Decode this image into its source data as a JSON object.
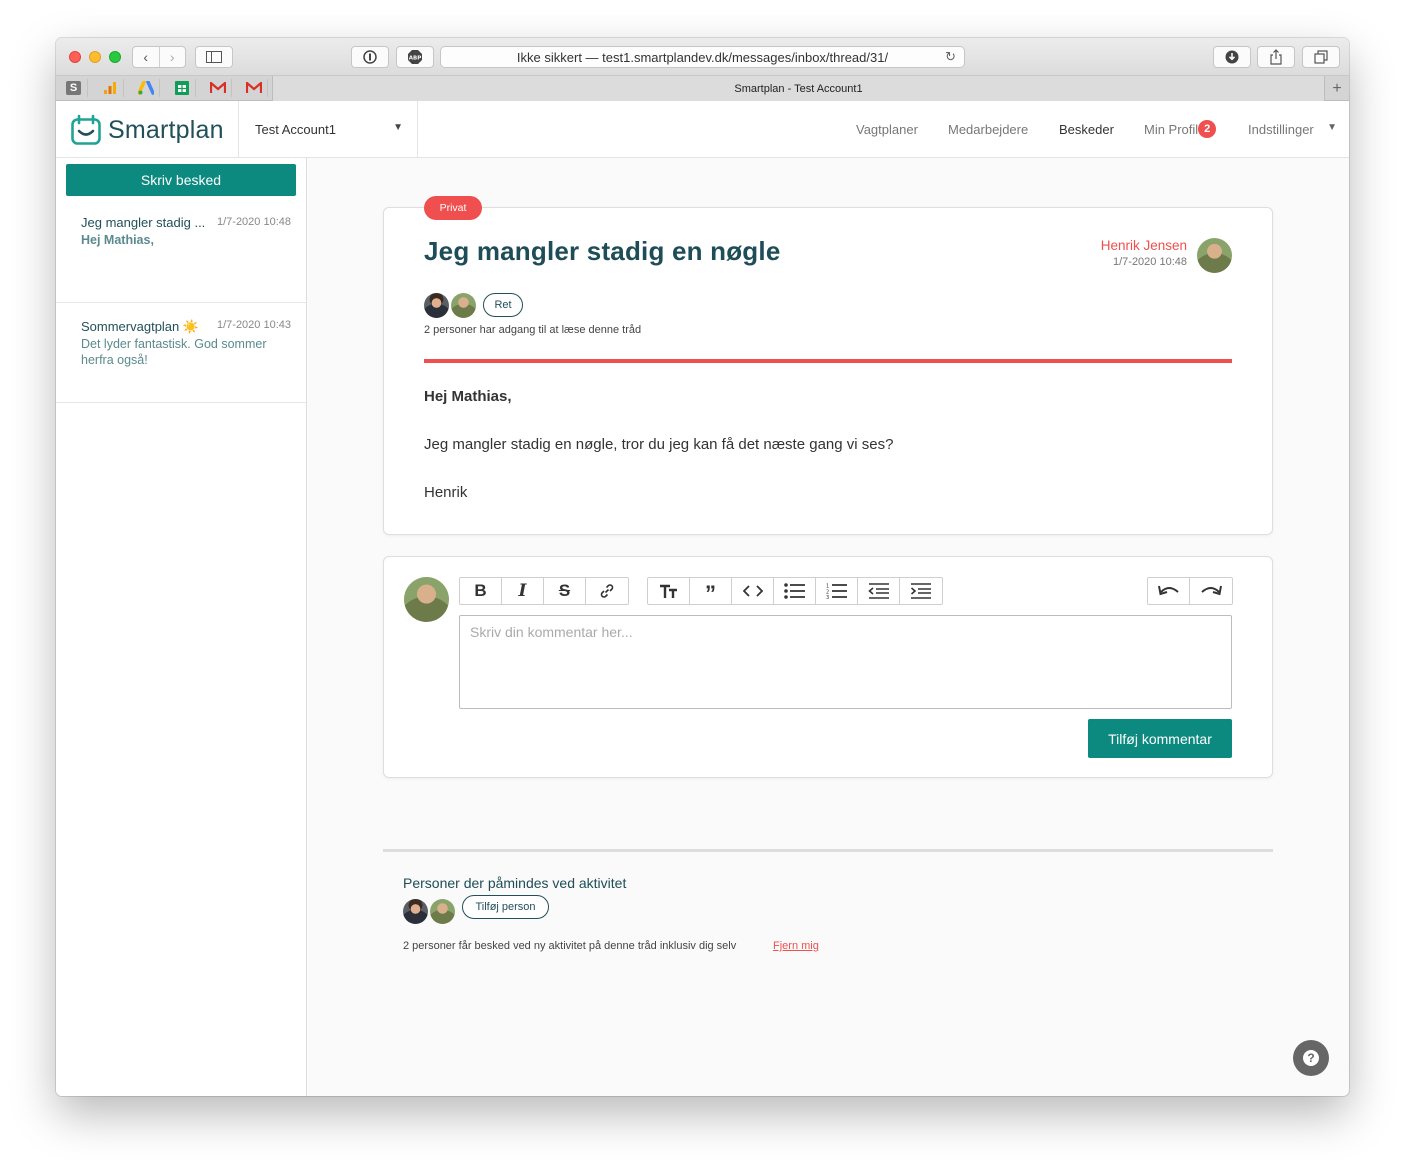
{
  "browser": {
    "url": "Ikke sikkert — test1.smartplandev.dk/messages/inbox/thread/31/",
    "tab_title": "Smartplan - Test Account1",
    "new_tab": "+"
  },
  "app": {
    "logo_text": "Smartplan",
    "account_name": "Test Account1",
    "nav": {
      "shifts": "Vagtplaner",
      "employees": "Medarbejdere",
      "messages": "Beskeder",
      "profile": "Min Profil",
      "profile_badge": "2",
      "settings": "Indstillinger"
    },
    "accent_color": "#0d8a80",
    "alert_color": "#ef4f4f"
  },
  "sidebar": {
    "compose_label": "Skriv besked",
    "threads": [
      {
        "title": "Jeg mangler stadig ...",
        "date": "1/7-2020 10:48",
        "snippet": "Hej Mathias,"
      },
      {
        "title": "Sommervagtplan",
        "emoji": "☀️",
        "date": "1/7-2020 10:43",
        "snippet": "Det lyder fantastisk. God sommer herfra også!"
      }
    ]
  },
  "message": {
    "privacy_label": "Privat",
    "title": "Jeg mangler stadig en nøgle",
    "author": "Henrik Jensen",
    "date": "1/7-2020 10:48",
    "edit_label": "Ret",
    "access_text": "2 personer har adgang til at læse denne tråd",
    "greeting": "Hej Mathias,",
    "body": "Jeg mangler stadig en nøgle, tror du jeg kan få det næste gang vi ses?",
    "signature": "Henrik"
  },
  "comment": {
    "placeholder": "Skriv din kommentar her...",
    "submit_label": "Tilføj kommentar"
  },
  "reminders": {
    "title": "Personer der påmindes ved aktivitet",
    "add_person_label": "Tilføj person",
    "info_text": "2 personer får besked ved ny aktivitet på denne tråd inklusiv dig selv",
    "remove_me_label": "Fjern mig"
  }
}
